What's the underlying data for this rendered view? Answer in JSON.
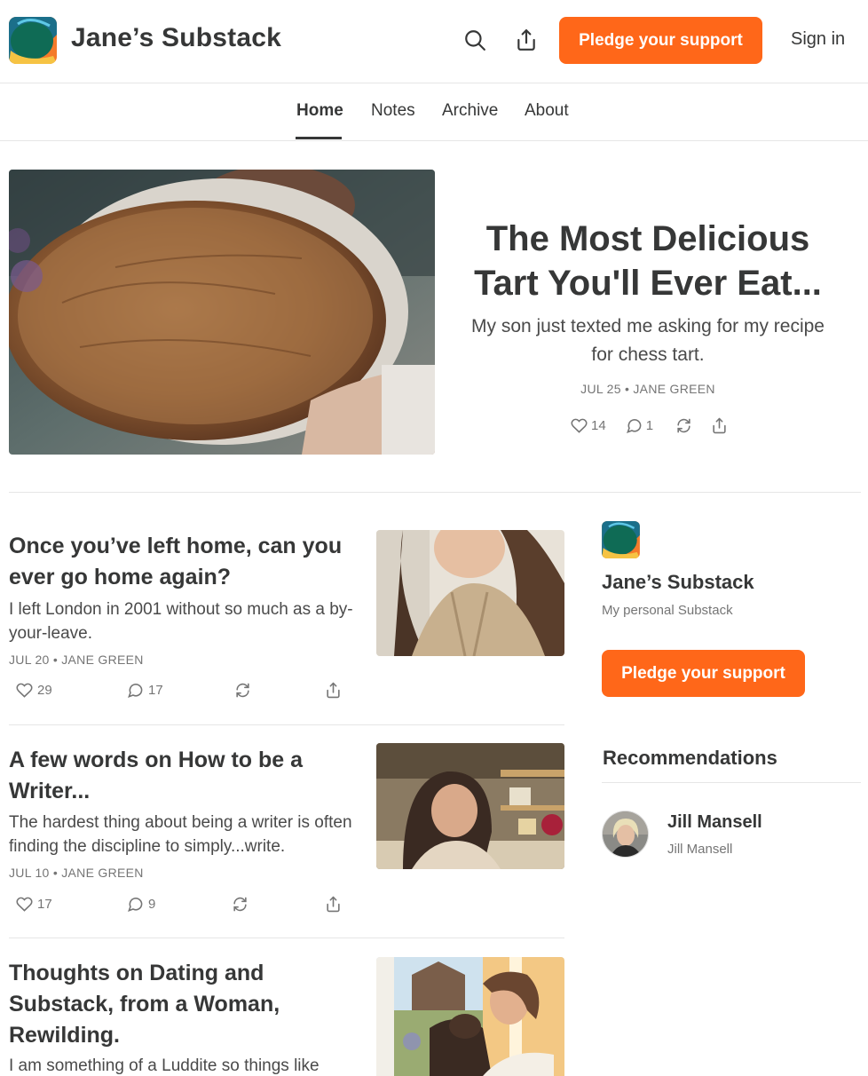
{
  "header": {
    "site_title": "Jane’s Substack",
    "pledge_label": "Pledge your support",
    "sign_in_label": "Sign in",
    "icons": [
      "search-icon",
      "share-icon"
    ]
  },
  "nav": {
    "tabs": [
      {
        "label": "Home",
        "active": true
      },
      {
        "label": "Notes",
        "active": false
      },
      {
        "label": "Archive",
        "active": false
      },
      {
        "label": "About",
        "active": false
      }
    ]
  },
  "hero": {
    "title": "The Most Delicious Tart You'll Ever Eat...",
    "subtitle": "My son just texted me asking for my recipe for chess tart.",
    "meta": "JUL 25 • JANE GREEN",
    "likes": "14",
    "comments": "1"
  },
  "posts": [
    {
      "title": "Once you’ve left home, can you ever go home again?",
      "subtitle": "I left London in 2001 without so much as a by-your-leave.",
      "meta": "JUL 20 • JANE GREEN",
      "likes": "29",
      "comments": "17"
    },
    {
      "title": "A few words on How to be a Writer...",
      "subtitle": "The hardest thing about being a writer is often finding the discipline to simply...write.",
      "meta": "JUL 10 • JANE GREEN",
      "likes": "17",
      "comments": "9"
    },
    {
      "title": "Thoughts on Dating and Substack, from a Woman, Rewilding.",
      "subtitle": "I am something of a Luddite so things like"
    }
  ],
  "sidebar": {
    "title": "Jane’s Substack",
    "description": "My personal Substack",
    "pledge_label": "Pledge your support",
    "recommendations_heading": "Recommendations",
    "recommendations": [
      {
        "name": "Jill Mansell",
        "handle": "Jill Mansell"
      }
    ]
  },
  "colors": {
    "accent": "#ff6719",
    "text": "#363737",
    "muted": "#757575",
    "divider": "#e6e6e6"
  }
}
